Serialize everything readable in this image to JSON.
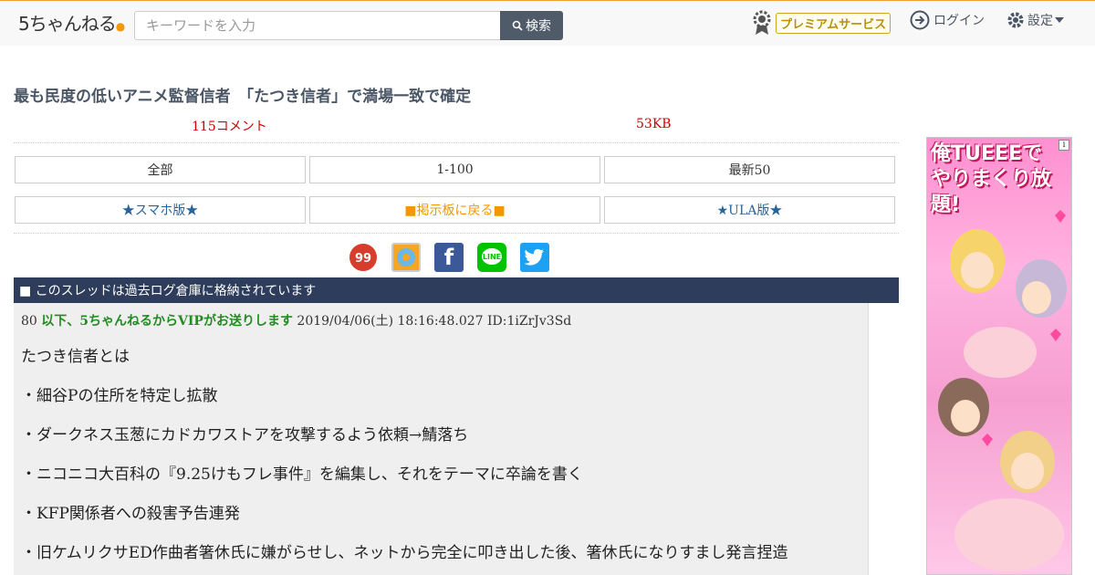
{
  "header": {
    "logo_text": "5ちゃんねる",
    "search_placeholder": "キーワードを入力",
    "search_button": "検索",
    "premium": "プレミアムサービス",
    "login": "ログイン",
    "settings": "設定"
  },
  "thread": {
    "title": "最も民度の低いアニメ監督信者　「たつき信者」で満場一致で確定",
    "comments": "115コメント",
    "size": "53KB"
  },
  "nav": {
    "row1": [
      "全部",
      "1-100",
      "最新50"
    ],
    "row2": [
      "★スマホ版★",
      "■掲示板に戻る■",
      "★ULA版★"
    ]
  },
  "share": [
    "5ch-icon",
    "blog-icon",
    "facebook-icon",
    "line-icon",
    "twitter-icon"
  ],
  "notice": "■ このスレッドは過去ログ倉庫に格納されています",
  "post": {
    "number": "80",
    "name": "以下、5ちゃんねるからVIPがお送りします",
    "date": "2019/04/06(土) 18:16:48.027",
    "id": "ID:1iZrJv3Sd",
    "lines": [
      "たつき信者とは",
      "・細谷Pの住所を特定し拡散",
      "・ダークネス玉葱にカドカワストアを攻撃するよう依頼→鯖落ち",
      "・ニコニコ大百科の『9.25けもフレ事件』を編集し、それをテーマに卒論を書く",
      "・KFP関係者への殺害予告連発",
      "・旧ケムリクサED作曲者箸休氏に嫌がらせし、ネットから完全に叩き出した後、箸休氏になりすまし発言捏造"
    ]
  },
  "ad": {
    "title_line1": "俺TUEEEで",
    "title_line2": "やりまくり放題!"
  },
  "colors": {
    "accent": "#f39800",
    "notice_bg": "#2e3d5c",
    "post_name": "#228b22",
    "meta_red": "#cc0000"
  }
}
